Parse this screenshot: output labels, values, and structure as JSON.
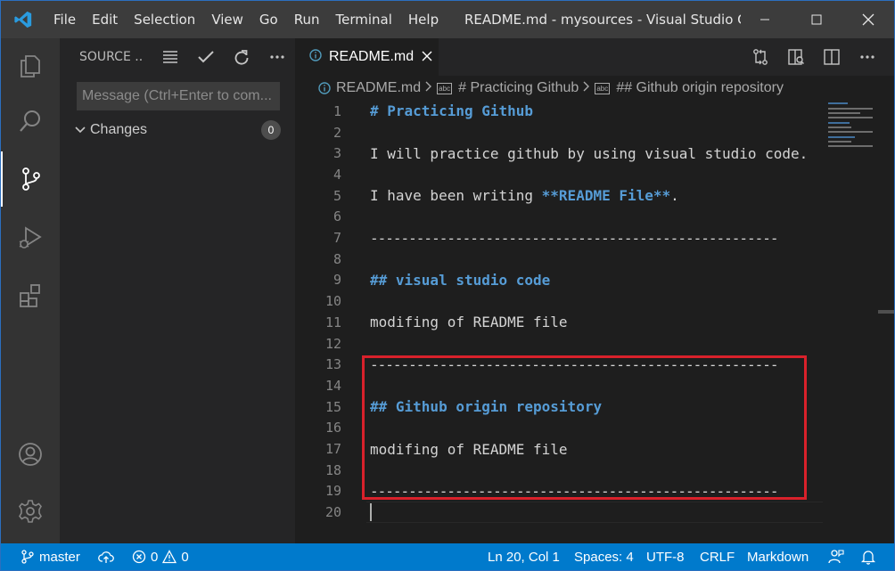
{
  "titlebar": {
    "menu": [
      "File",
      "Edit",
      "Selection",
      "View",
      "Go",
      "Run",
      "Terminal",
      "Help"
    ],
    "window_title": "README.md - mysources - Visual Studio C..."
  },
  "activity_bar": {
    "items": [
      "explorer-icon",
      "search-icon",
      "source-control-icon",
      "run-debug-icon",
      "extensions-icon"
    ],
    "bottom": [
      "account-icon",
      "settings-gear-icon"
    ]
  },
  "sidebar": {
    "title": "SOURCE ...",
    "message_placeholder": "Message (Ctrl+Enter to com...",
    "changes_label": "Changes",
    "changes_count": "0"
  },
  "editor": {
    "tab_label": "README.md",
    "breadcrumb": [
      "README.md",
      "# Practicing Github",
      "## Github origin repository"
    ],
    "lines": [
      {
        "num": "1",
        "text": "# Practicing Github",
        "kind": "heading"
      },
      {
        "num": "2",
        "text": "",
        "kind": "text"
      },
      {
        "num": "3",
        "text": "I will practice github by using visual studio code.",
        "kind": "text"
      },
      {
        "num": "4",
        "text": "",
        "kind": "text"
      },
      {
        "num": "5",
        "text_pre": "I have been writing ",
        "text_bold": "**README File**",
        "text_post": ".",
        "kind": "mixed"
      },
      {
        "num": "6",
        "text": "",
        "kind": "text"
      },
      {
        "num": "7",
        "text": "-----------------------------------------------------",
        "kind": "text"
      },
      {
        "num": "8",
        "text": "",
        "kind": "text"
      },
      {
        "num": "9",
        "text": "## visual studio code",
        "kind": "heading"
      },
      {
        "num": "10",
        "text": "",
        "kind": "text"
      },
      {
        "num": "11",
        "text": "modifing of README file",
        "kind": "text"
      },
      {
        "num": "12",
        "text": "",
        "kind": "text"
      },
      {
        "num": "13",
        "text": "-----------------------------------------------------",
        "kind": "text"
      },
      {
        "num": "14",
        "text": "",
        "kind": "text"
      },
      {
        "num": "15",
        "text": "## Github origin repository",
        "kind": "heading"
      },
      {
        "num": "16",
        "text": "",
        "kind": "text"
      },
      {
        "num": "17",
        "text": "modifing of README file",
        "kind": "text"
      },
      {
        "num": "18",
        "text": "",
        "kind": "text"
      },
      {
        "num": "19",
        "text": "-----------------------------------------------------",
        "kind": "text"
      },
      {
        "num": "20",
        "text": "",
        "kind": "text"
      }
    ]
  },
  "statusbar": {
    "branch": "master",
    "errors": "0",
    "warnings": "0",
    "position": "Ln 20, Col 1",
    "spaces": "Spaces: 4",
    "encoding": "UTF-8",
    "eol": "CRLF",
    "language": "Markdown"
  },
  "colors": {
    "accent": "#007acc",
    "heading": "#569cd6",
    "highlight_box": "#d9212b"
  }
}
